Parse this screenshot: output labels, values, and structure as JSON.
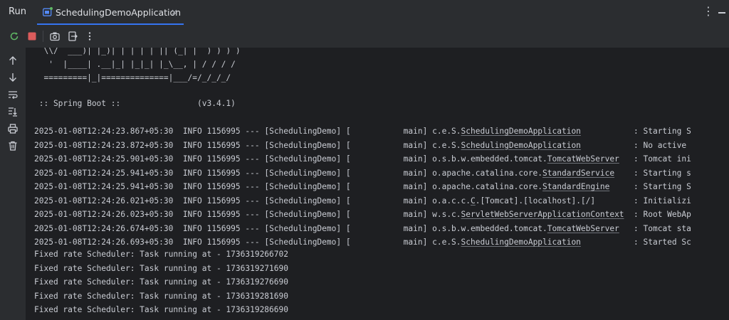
{
  "header": {
    "run_title": "Run",
    "tab_label": "SchedulingDemoApplication",
    "tab_close": "×",
    "more_label": "⋮",
    "icons": [
      "rerun-icon",
      "stop-icon",
      "camera-icon",
      "exit-icon",
      "more-icon"
    ]
  },
  "side_tools": [
    "arrow-up-icon",
    "arrow-down-icon",
    "soft-wrap-icon",
    "scroll-to-end-icon",
    "print-icon",
    "trash-icon"
  ],
  "banner": [
    "  \\\\/  ___)| |_)| | | | | || (_| |  ) ) ) )",
    "   '  |____| .__|_| |_|_| |_\\__, | / / / /",
    "  =========|_|==============|___/=/_/_/_/",
    "",
    " :: Spring Boot ::                (v3.4.1)"
  ],
  "log_rows": [
    {
      "ts": "2025-01-08T12:24:23.867+05:30",
      "level": "INFO",
      "pid": "1156995",
      "sep": "---",
      "app": "[SchedulingDemo]",
      "thread": "[           main]",
      "pkg": "c.e.S.",
      "cls": "SchedulingDemoApplication",
      "pad": "          ",
      "msg": ": Starting S"
    },
    {
      "ts": "2025-01-08T12:24:23.872+05:30",
      "level": "INFO",
      "pid": "1156995",
      "sep": "---",
      "app": "[SchedulingDemo]",
      "thread": "[           main]",
      "pkg": "c.e.S.",
      "cls": "SchedulingDemoApplication",
      "pad": "          ",
      "msg": ": No active"
    },
    {
      "ts": "2025-01-08T12:24:25.901+05:30",
      "level": "INFO",
      "pid": "1156995",
      "sep": "---",
      "app": "[SchedulingDemo]",
      "thread": "[           main]",
      "pkg": "o.s.b.w.embedded.tomcat.",
      "cls": "TomcatWebServer",
      "pad": "  ",
      "msg": ": Tomcat ini"
    },
    {
      "ts": "2025-01-08T12:24:25.941+05:30",
      "level": "INFO",
      "pid": "1156995",
      "sep": "---",
      "app": "[SchedulingDemo]",
      "thread": "[           main]",
      "pkg": "o.apache.catalina.core.",
      "cls": "StandardService",
      "pad": "   ",
      "msg": ": Starting s"
    },
    {
      "ts": "2025-01-08T12:24:25.941+05:30",
      "level": "INFO",
      "pid": "1156995",
      "sep": "---",
      "app": "[SchedulingDemo]",
      "thread": "[           main]",
      "pkg": "o.apache.catalina.core.",
      "cls": "StandardEngine",
      "pad": "    ",
      "msg": ": Starting S"
    },
    {
      "ts": "2025-01-08T12:24:26.021+05:30",
      "level": "INFO",
      "pid": "1156995",
      "sep": "---",
      "app": "[SchedulingDemo]",
      "thread": "[           main]",
      "pkg": "o.a.c.c.",
      "cls": "C",
      "pad": ".[Tomcat].[localhost].[/]       ",
      "msg": ": Initializi"
    },
    {
      "ts": "2025-01-08T12:24:26.023+05:30",
      "level": "INFO",
      "pid": "1156995",
      "sep": "---",
      "app": "[SchedulingDemo]",
      "thread": "[           main]",
      "pkg": "w.s.c.",
      "cls": "ServletWebServerApplicationContext",
      "pad": " ",
      "msg": ": Root WebAp"
    },
    {
      "ts": "2025-01-08T12:24:26.674+05:30",
      "level": "INFO",
      "pid": "1156995",
      "sep": "---",
      "app": "[SchedulingDemo]",
      "thread": "[           main]",
      "pkg": "o.s.b.w.embedded.tomcat.",
      "cls": "TomcatWebServer",
      "pad": "  ",
      "msg": ": Tomcat sta"
    },
    {
      "ts": "2025-01-08T12:24:26.693+05:30",
      "level": "INFO",
      "pid": "1156995",
      "sep": "---",
      "app": "[SchedulingDemo]",
      "thread": "[           main]",
      "pkg": "c.e.S.",
      "cls": "SchedulingDemoApplication",
      "pad": "          ",
      "msg": ": Started Sc"
    }
  ],
  "output_rows": [
    "Fixed rate Scheduler: Task running at - 1736319266702",
    "Fixed rate Scheduler: Task running at - 1736319271690",
    "Fixed rate Scheduler: Task running at - 1736319276690",
    "Fixed rate Scheduler: Task running at - 1736319281690",
    "Fixed rate Scheduler: Task running at - 1736319286690"
  ],
  "colors": {
    "accent": "#3574f0",
    "stop": "#db5c5c",
    "rerun": "#5fb865",
    "console_bg": "#1e1f22",
    "panel_bg": "#2b2d30"
  }
}
